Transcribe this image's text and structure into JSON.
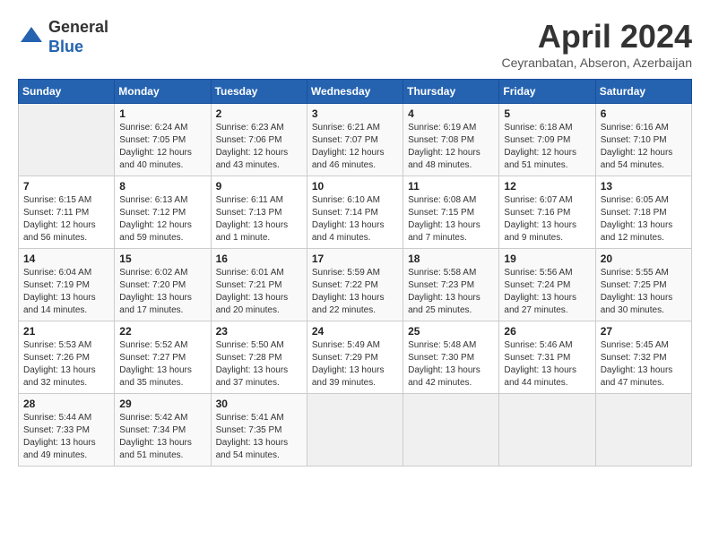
{
  "header": {
    "logo_general": "General",
    "logo_blue": "Blue",
    "month_title": "April 2024",
    "location": "Ceyranbatan, Abseron, Azerbaijan"
  },
  "weekdays": [
    "Sunday",
    "Monday",
    "Tuesday",
    "Wednesday",
    "Thursday",
    "Friday",
    "Saturday"
  ],
  "weeks": [
    [
      {
        "num": "",
        "info": ""
      },
      {
        "num": "1",
        "info": "Sunrise: 6:24 AM\nSunset: 7:05 PM\nDaylight: 12 hours\nand 40 minutes."
      },
      {
        "num": "2",
        "info": "Sunrise: 6:23 AM\nSunset: 7:06 PM\nDaylight: 12 hours\nand 43 minutes."
      },
      {
        "num": "3",
        "info": "Sunrise: 6:21 AM\nSunset: 7:07 PM\nDaylight: 12 hours\nand 46 minutes."
      },
      {
        "num": "4",
        "info": "Sunrise: 6:19 AM\nSunset: 7:08 PM\nDaylight: 12 hours\nand 48 minutes."
      },
      {
        "num": "5",
        "info": "Sunrise: 6:18 AM\nSunset: 7:09 PM\nDaylight: 12 hours\nand 51 minutes."
      },
      {
        "num": "6",
        "info": "Sunrise: 6:16 AM\nSunset: 7:10 PM\nDaylight: 12 hours\nand 54 minutes."
      }
    ],
    [
      {
        "num": "7",
        "info": "Sunrise: 6:15 AM\nSunset: 7:11 PM\nDaylight: 12 hours\nand 56 minutes."
      },
      {
        "num": "8",
        "info": "Sunrise: 6:13 AM\nSunset: 7:12 PM\nDaylight: 12 hours\nand 59 minutes."
      },
      {
        "num": "9",
        "info": "Sunrise: 6:11 AM\nSunset: 7:13 PM\nDaylight: 13 hours\nand 1 minute."
      },
      {
        "num": "10",
        "info": "Sunrise: 6:10 AM\nSunset: 7:14 PM\nDaylight: 13 hours\nand 4 minutes."
      },
      {
        "num": "11",
        "info": "Sunrise: 6:08 AM\nSunset: 7:15 PM\nDaylight: 13 hours\nand 7 minutes."
      },
      {
        "num": "12",
        "info": "Sunrise: 6:07 AM\nSunset: 7:16 PM\nDaylight: 13 hours\nand 9 minutes."
      },
      {
        "num": "13",
        "info": "Sunrise: 6:05 AM\nSunset: 7:18 PM\nDaylight: 13 hours\nand 12 minutes."
      }
    ],
    [
      {
        "num": "14",
        "info": "Sunrise: 6:04 AM\nSunset: 7:19 PM\nDaylight: 13 hours\nand 14 minutes."
      },
      {
        "num": "15",
        "info": "Sunrise: 6:02 AM\nSunset: 7:20 PM\nDaylight: 13 hours\nand 17 minutes."
      },
      {
        "num": "16",
        "info": "Sunrise: 6:01 AM\nSunset: 7:21 PM\nDaylight: 13 hours\nand 20 minutes."
      },
      {
        "num": "17",
        "info": "Sunrise: 5:59 AM\nSunset: 7:22 PM\nDaylight: 13 hours\nand 22 minutes."
      },
      {
        "num": "18",
        "info": "Sunrise: 5:58 AM\nSunset: 7:23 PM\nDaylight: 13 hours\nand 25 minutes."
      },
      {
        "num": "19",
        "info": "Sunrise: 5:56 AM\nSunset: 7:24 PM\nDaylight: 13 hours\nand 27 minutes."
      },
      {
        "num": "20",
        "info": "Sunrise: 5:55 AM\nSunset: 7:25 PM\nDaylight: 13 hours\nand 30 minutes."
      }
    ],
    [
      {
        "num": "21",
        "info": "Sunrise: 5:53 AM\nSunset: 7:26 PM\nDaylight: 13 hours\nand 32 minutes."
      },
      {
        "num": "22",
        "info": "Sunrise: 5:52 AM\nSunset: 7:27 PM\nDaylight: 13 hours\nand 35 minutes."
      },
      {
        "num": "23",
        "info": "Sunrise: 5:50 AM\nSunset: 7:28 PM\nDaylight: 13 hours\nand 37 minutes."
      },
      {
        "num": "24",
        "info": "Sunrise: 5:49 AM\nSunset: 7:29 PM\nDaylight: 13 hours\nand 39 minutes."
      },
      {
        "num": "25",
        "info": "Sunrise: 5:48 AM\nSunset: 7:30 PM\nDaylight: 13 hours\nand 42 minutes."
      },
      {
        "num": "26",
        "info": "Sunrise: 5:46 AM\nSunset: 7:31 PM\nDaylight: 13 hours\nand 44 minutes."
      },
      {
        "num": "27",
        "info": "Sunrise: 5:45 AM\nSunset: 7:32 PM\nDaylight: 13 hours\nand 47 minutes."
      }
    ],
    [
      {
        "num": "28",
        "info": "Sunrise: 5:44 AM\nSunset: 7:33 PM\nDaylight: 13 hours\nand 49 minutes."
      },
      {
        "num": "29",
        "info": "Sunrise: 5:42 AM\nSunset: 7:34 PM\nDaylight: 13 hours\nand 51 minutes."
      },
      {
        "num": "30",
        "info": "Sunrise: 5:41 AM\nSunset: 7:35 PM\nDaylight: 13 hours\nand 54 minutes."
      },
      {
        "num": "",
        "info": ""
      },
      {
        "num": "",
        "info": ""
      },
      {
        "num": "",
        "info": ""
      },
      {
        "num": "",
        "info": ""
      }
    ]
  ]
}
